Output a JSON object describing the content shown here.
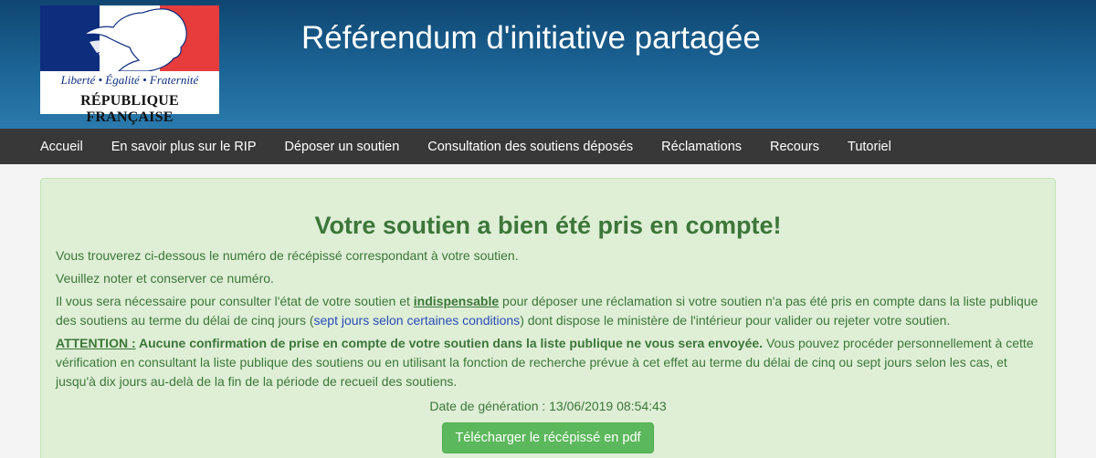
{
  "header": {
    "title": "Référendum d'initiative partagée",
    "logo": {
      "motto": "Liberté • Égalité • Fraternité",
      "name": "RÉPUBLIQUE FRANÇAISE",
      "colors": [
        "#0d2d7d",
        "#ffffff",
        "#e63c3c"
      ]
    }
  },
  "nav": {
    "items": [
      "Accueil",
      "En savoir plus sur le RIP",
      "Déposer un soutien",
      "Consultation des soutiens déposés",
      "Réclamations",
      "Recours",
      "Tutoriel"
    ]
  },
  "main": {
    "heading": "Votre soutien a bien été pris en compte!",
    "p1": "Vous trouverez ci-dessous le numéro de récépissé correspondant à votre soutien.",
    "p2": "Veuillez noter et conserver ce numéro.",
    "p3_a": "Il vous sera nécessaire pour consulter l'état de votre soutien et ",
    "p3_strong": "indispensable",
    "p3_b": " pour déposer une réclamation si votre soutien n'a pas été pris en compte dans la liste publique des soutiens au terme du délai de cinq jours (",
    "p3_link": "sept jours selon certaines conditions",
    "p3_c": ") dont dispose le ministère de l'intérieur pour valider ou rejeter votre soutien.",
    "p4_label": "ATTENTION :",
    "p4_strong": " Aucune confirmation de prise en compte de votre soutien dans la liste publique ne vous sera envoyée.",
    "p4_rest": " Vous pouvez procéder personnellement à cette vérification en consultant la liste publique des soutiens ou en utilisant la fonction de recherche prévue à cet effet au terme du délai de cinq ou sept jours selon les cas, et jusqu'à dix jours au-delà de la fin de la période de recueil des soutiens.",
    "date_line": "Date de génération : 13/06/2019 08:54:43",
    "download_button": "Télécharger le récépissé en pdf"
  },
  "colors": {
    "header_bg": "#1c6596",
    "nav_bg": "#383838",
    "panel_bg": "#deefd6",
    "panel_text": "#3d763a",
    "link": "#2a4bb8",
    "button": "#5cb85c"
  }
}
